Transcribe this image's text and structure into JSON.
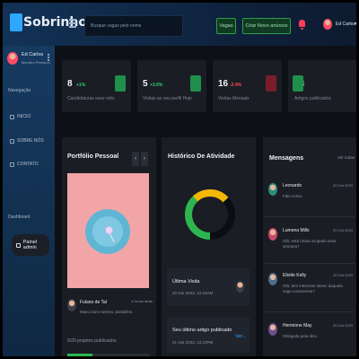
{
  "header": {
    "logo_text": "Sobrinhos",
    "search_placeholder": "Busque vagas pelo nome",
    "vagas_label": "Vagas",
    "create_label": "Criar Novo anúncio",
    "user_name": "Ed Carlos"
  },
  "sidebar": {
    "user_name": "Ed Carlos",
    "user_plan": "Membro Premium",
    "nav_section": "Navegação",
    "items": [
      {
        "label": "INICIO",
        "icon": "home-icon"
      },
      {
        "label": "SOBRE NÓS",
        "icon": "info-icon"
      },
      {
        "label": "CONTATO",
        "icon": "phone-icon"
      }
    ],
    "dash_section": "Dashboard",
    "active_item": "Painel admin"
  },
  "stats": [
    {
      "value": "8",
      "delta": "+1%",
      "delta_color": "#2ecc71",
      "label": "Candidaturas esse mês",
      "icon_color": "#1f8f4c"
    },
    {
      "value": "5",
      "delta": "+3.6%",
      "delta_color": "#2ecc71",
      "label": "Visitas ao seu perfil Hoje",
      "icon_color": "#1f8f4c"
    },
    {
      "value": "16",
      "delta": "-2.4%",
      "delta_color": "#ff4d4d",
      "label": "Visitas Mensais",
      "icon_color": "#7a1d2a"
    },
    {
      "value": "23",
      "delta": "",
      "delta_color": "#2ecc71",
      "label": "Artigos publicados",
      "icon_color": "#1f8f4c"
    }
  ],
  "portfolio": {
    "title": "Portfólio Pessoal",
    "prev": "‹",
    "next": "›",
    "author": "Fulano de Tal",
    "time": "4 Horas atrás",
    "message": "Muito bom mesmo, parabéns.",
    "projects": "6/20 projetos publicados.",
    "progress": 0.3,
    "progress_label": "30%"
  },
  "activity": {
    "title": "Histórico De Atividade",
    "donut_segments": [
      {
        "color": "#2db650",
        "fraction": 0.38
      },
      {
        "color": "#f2b707",
        "fraction": 0.25
      },
      {
        "color": "#0b0d12",
        "fraction": 0.37
      }
    ],
    "last_visit_title": "Última Visita",
    "last_visit_date": "20 Out 2023, 12:10AM",
    "last_article_title": "Seu último artigo publicado",
    "last_article_date": "21 Out 2023, 12:10PM",
    "see_more": "Ver..."
  },
  "messages": {
    "title": "Mensagens",
    "see_all": "Ver todas",
    "items": [
      {
        "name": "Leonardo",
        "date": "20 Out 2023",
        "text": "Falo como.",
        "avatar_color": "#2a8f7a"
      },
      {
        "name": "Lumena Mills",
        "date": "20 Out 2023",
        "text": "Olá, está muito ocupado essa semana?",
        "avatar_color": "#c8496b"
      },
      {
        "name": "Eliotte Kelly",
        "date": "20 Out 2023",
        "text": "Olá, tem interesse talvez daquela vaga novamente?",
        "avatar_color": "#4f6c8a"
      },
      {
        "name": "Hermione May",
        "date": "20 Out 2023",
        "text": "Obrigada pela dica.",
        "avatar_color": "#6c4f8a"
      }
    ]
  }
}
